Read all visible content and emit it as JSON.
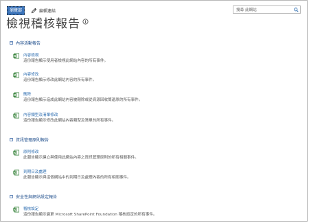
{
  "topbar": {
    "home_label": "瀏覽部",
    "edit_label": "編輯連結"
  },
  "search": {
    "placeholder": "搜尋 此網站"
  },
  "page": {
    "title": "檢視稽核報告"
  },
  "sections": [
    {
      "title": "內容活動報告",
      "items": [
        {
          "name": "內容檢視",
          "desc": "這份報告顯示使用者檢視此網站內容的所有事件。"
        },
        {
          "name": "內容修改",
          "desc": "這份報告顯示修改此網站內容的所有事件。"
        },
        {
          "name": "刪除",
          "desc": "這份報告顯示造成此網站內容被刪除或從資源回收筒還原的所有事件。"
        },
        {
          "name": "內容類型及清單修改",
          "desc": "這份報告顯示修改此網站內容類型及清單的所有事件。"
        }
      ]
    },
    {
      "title": "資訊管理原則報告",
      "items": [
        {
          "name": "原則修改",
          "desc": "此報告顯示建立與使用此網站內容之資訊管理原則的所有相關事件。"
        },
        {
          "name": "到期日及處理",
          "desc": "此報告顯示與這個網站中的到期日及處理內容的所有相關事件。"
        }
      ]
    },
    {
      "title": "安全性與網站設定報告",
      "items": [
        {
          "name": "稽核設定",
          "desc": "這份報告顯示變更 Microsoft SharePoint Foundation 稽核設定的所有事件。"
        }
      ]
    }
  ]
}
